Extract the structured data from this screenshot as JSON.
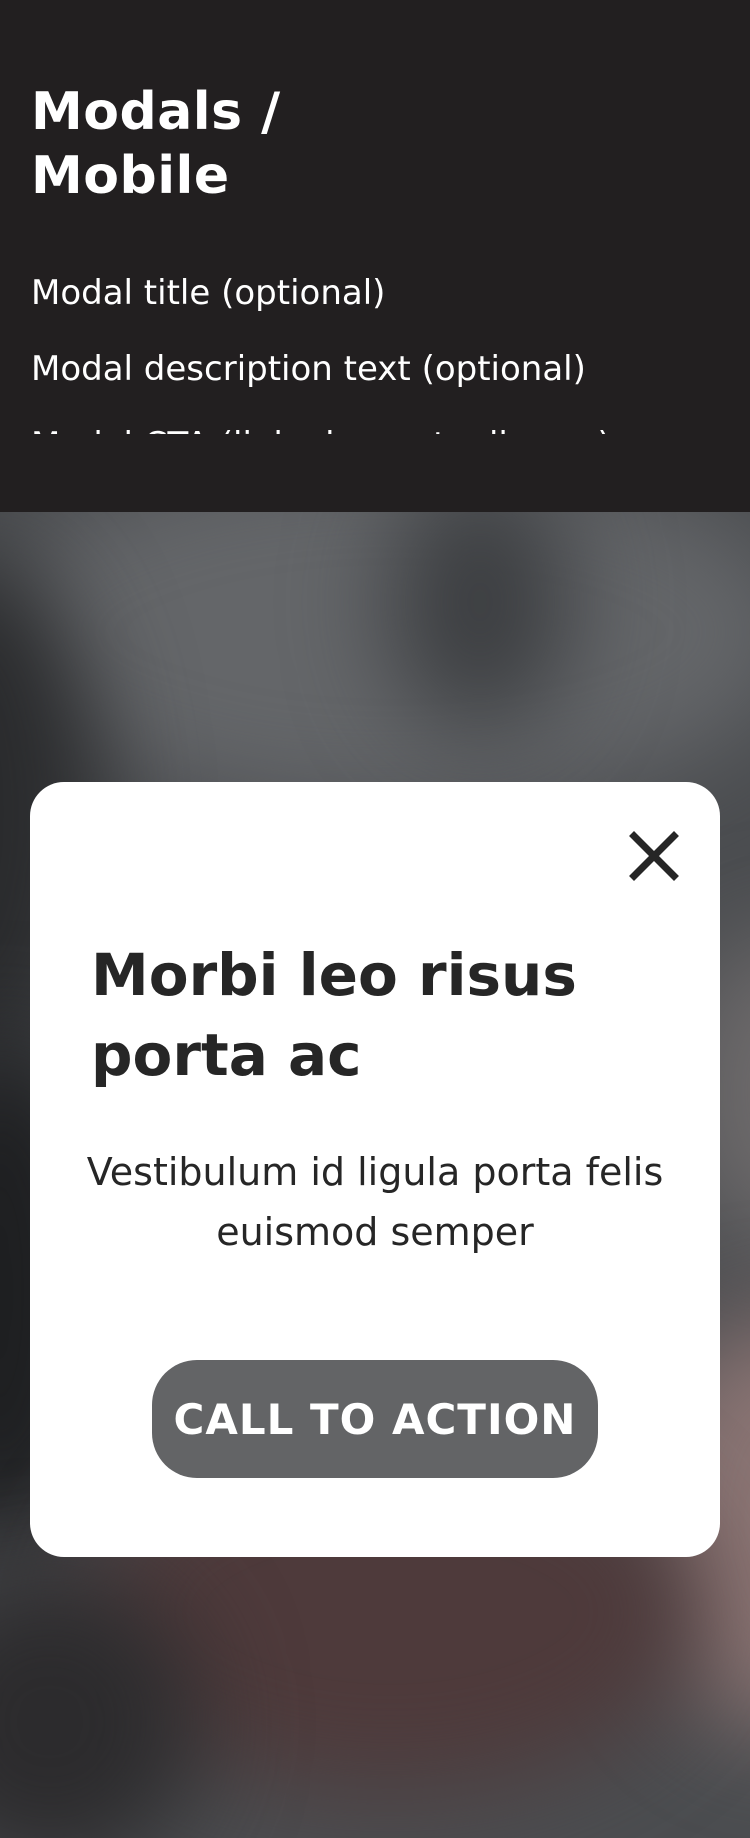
{
  "header": {
    "title_line1": "Modals /",
    "title_line2": "Mobile",
    "spec_items": [
      "Modal title (optional)",
      "Modal description text (optional)",
      "Modal CTA (linked or not, all caps)"
    ]
  },
  "modal": {
    "title": "Morbi leo risus porta ac",
    "description": "Vestibulum id ligula porta felis euismod semper",
    "cta_label": "CALL TO ACTION",
    "close_icon": "close-icon"
  },
  "colors": {
    "header_bg": "#221f20",
    "modal_bg": "#ffffff",
    "cta_bg": "#636466",
    "text_dark": "#262626",
    "text_light": "#ffffff"
  }
}
